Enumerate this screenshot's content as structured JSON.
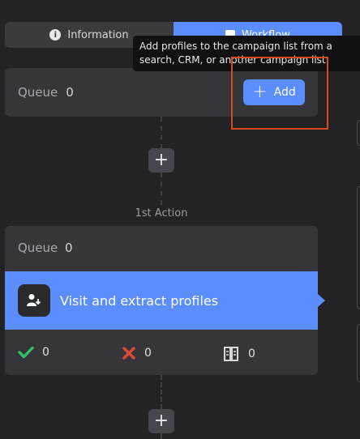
{
  "tabs": {
    "information_label": "Information",
    "workflow_label": "Workflow"
  },
  "tooltip": {
    "text": "Add profiles to the campaign list from a search, CRM, or another campaign list."
  },
  "queue": {
    "label": "Queue",
    "count": "0",
    "add_label": "Add"
  },
  "first_action": {
    "label": "1st Action",
    "queue_label": "Queue",
    "queue_count": "0",
    "title": "Visit and extract profiles",
    "stats": {
      "success": "0",
      "failed": "0",
      "skipped": "0"
    }
  },
  "colors": {
    "accent": "#5b8dfc",
    "success": "#35c26b",
    "error": "#e2473b",
    "highlight": "#d8491d"
  },
  "icons": [
    "info-icon",
    "workflow-icon",
    "plus-icon",
    "user-download-icon",
    "check-icon",
    "x-icon",
    "skip-icon"
  ]
}
